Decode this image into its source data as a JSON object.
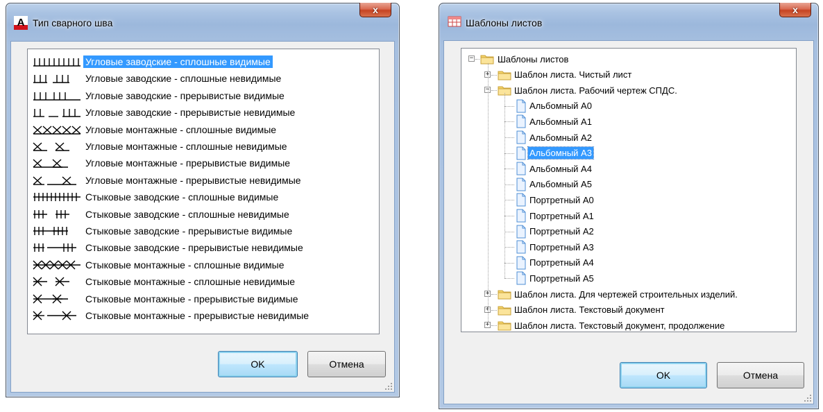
{
  "weld_dialog": {
    "title": "Тип сварного шва",
    "close_label": "x",
    "items": [
      {
        "label": "Угловые заводские - сплошные видимые",
        "selected": true,
        "glyph": "fillet-factory-solid-visible"
      },
      {
        "label": "Угловые заводские - сплошные невидимые",
        "glyph": "fillet-factory-solid-hidden"
      },
      {
        "label": "Угловые заводские - прерывистые видимые",
        "glyph": "fillet-factory-intermittent-visible"
      },
      {
        "label": "Угловые заводские - прерывистые невидимые",
        "glyph": "fillet-factory-intermittent-hidden"
      },
      {
        "label": "Угловые монтажные - сплошные видимые",
        "glyph": "fillet-site-solid-visible"
      },
      {
        "label": "Угловые монтажные - сплошные невидимые",
        "glyph": "fillet-site-solid-hidden"
      },
      {
        "label": "Угловые монтажные - прерывистые видимые",
        "glyph": "fillet-site-intermittent-visible"
      },
      {
        "label": "Угловые монтажные - прерывистые невидимые",
        "glyph": "fillet-site-intermittent-hidden"
      },
      {
        "label": "Стыковые заводские - сплошные видимые",
        "glyph": "butt-factory-solid-visible"
      },
      {
        "label": "Стыковые заводские - сплошные невидимые",
        "glyph": "butt-factory-solid-hidden"
      },
      {
        "label": "Стыковые заводские - прерывистые видимые",
        "glyph": "butt-factory-intermittent-visible"
      },
      {
        "label": "Стыковые заводские - прерывистые невидимые",
        "glyph": "butt-factory-intermittent-hidden"
      },
      {
        "label": "Стыковые монтажные - сплошные видимые",
        "glyph": "butt-site-solid-visible"
      },
      {
        "label": "Стыковые монтажные - сплошные невидимые",
        "glyph": "butt-site-solid-hidden"
      },
      {
        "label": "Стыковые монтажные - прерывистые видимые",
        "glyph": "butt-site-intermittent-visible"
      },
      {
        "label": "Стыковые монтажные - прерывистые невидимые",
        "glyph": "butt-site-intermittent-hidden"
      }
    ],
    "ok_label": "OK",
    "cancel_label": "Отмена"
  },
  "templates_dialog": {
    "title": "Шаблоны листов",
    "close_label": "x",
    "tree": {
      "root": "Шаблоны листов",
      "nodes": [
        {
          "label": "Шаблон листа. Чистый лист",
          "expanded": false,
          "children": []
        },
        {
          "label": "Шаблон листа. Рабочий чертеж СПДС.",
          "expanded": true,
          "children": [
            {
              "label": "Альбомный А0"
            },
            {
              "label": "Альбомный А1"
            },
            {
              "label": "Альбомный А2"
            },
            {
              "label": "Альбомный А3",
              "selected": true
            },
            {
              "label": "Альбомный А4"
            },
            {
              "label": "Альбомный А5"
            },
            {
              "label": "Портретный А0"
            },
            {
              "label": "Портретный А1"
            },
            {
              "label": "Портретный А2"
            },
            {
              "label": "Портретный А3"
            },
            {
              "label": "Портретный А4"
            },
            {
              "label": "Портретный А5"
            }
          ]
        },
        {
          "label": "Шаблон листа. Для чертежей строительных изделий.",
          "expanded": false,
          "children": []
        },
        {
          "label": "Шаблон листа. Текстовый документ",
          "expanded": false,
          "children": []
        },
        {
          "label": "Шаблон листа. Текстовый документ, продолжение",
          "expanded": false,
          "children": []
        }
      ]
    },
    "ok_label": "OK",
    "cancel_label": "Отмена"
  },
  "colors": {
    "selection": "#3399ff",
    "close_red": "#c64322",
    "folder_yellow": "#f6d56a",
    "doc_blue": "#4f8fd6"
  }
}
